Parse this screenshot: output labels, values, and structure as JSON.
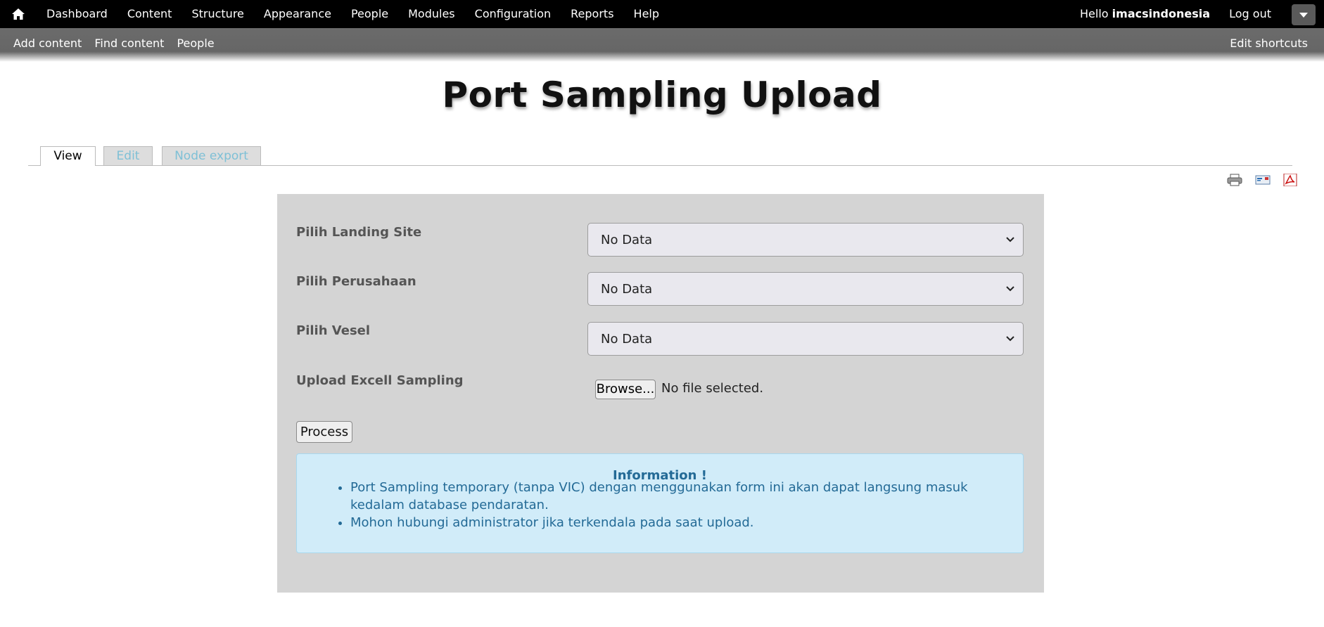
{
  "toolbar": {
    "menu": [
      "Dashboard",
      "Content",
      "Structure",
      "Appearance",
      "People",
      "Modules",
      "Configuration",
      "Reports",
      "Help"
    ],
    "hello": "Hello",
    "username": "imacsindonesia",
    "logout": "Log out"
  },
  "shortcuts": {
    "items": [
      "Add content",
      "Find content",
      "People"
    ],
    "edit": "Edit shortcuts"
  },
  "page": {
    "title": "Port Sampling Upload"
  },
  "tabs": [
    {
      "label": "View",
      "active": true
    },
    {
      "label": "Edit",
      "active": false
    },
    {
      "label": "Node export",
      "active": false
    }
  ],
  "utility_icons": [
    "print-icon",
    "email-icon",
    "pdf-icon"
  ],
  "form": {
    "landing_site": {
      "label": "Pilih Landing Site",
      "value": "No Data"
    },
    "perusahaan": {
      "label": "Pilih Perusahaan",
      "value": "No Data"
    },
    "vesel": {
      "label": "Pilih Vesel",
      "value": "No Data"
    },
    "upload": {
      "label": "Upload Excell Sampling",
      "button": "Browse...",
      "status": "No file selected."
    },
    "process_label": "Process"
  },
  "info": {
    "title": "Information !",
    "items": [
      "Port Sampling temporary (tanpa VIC) dengan menggunakan form ini akan dapat langsung masuk kedalam database pendaratan.",
      "Mohon hubungi administrator jika terkendala pada saat upload."
    ]
  },
  "colors": {
    "toolbar_bg": "#000000",
    "shortcut_bg": "#666666",
    "panel_bg": "#d4d4d4",
    "info_bg": "#d1ecf9",
    "info_text": "#236a96",
    "tab_inactive_text": "#7ec0d6"
  }
}
